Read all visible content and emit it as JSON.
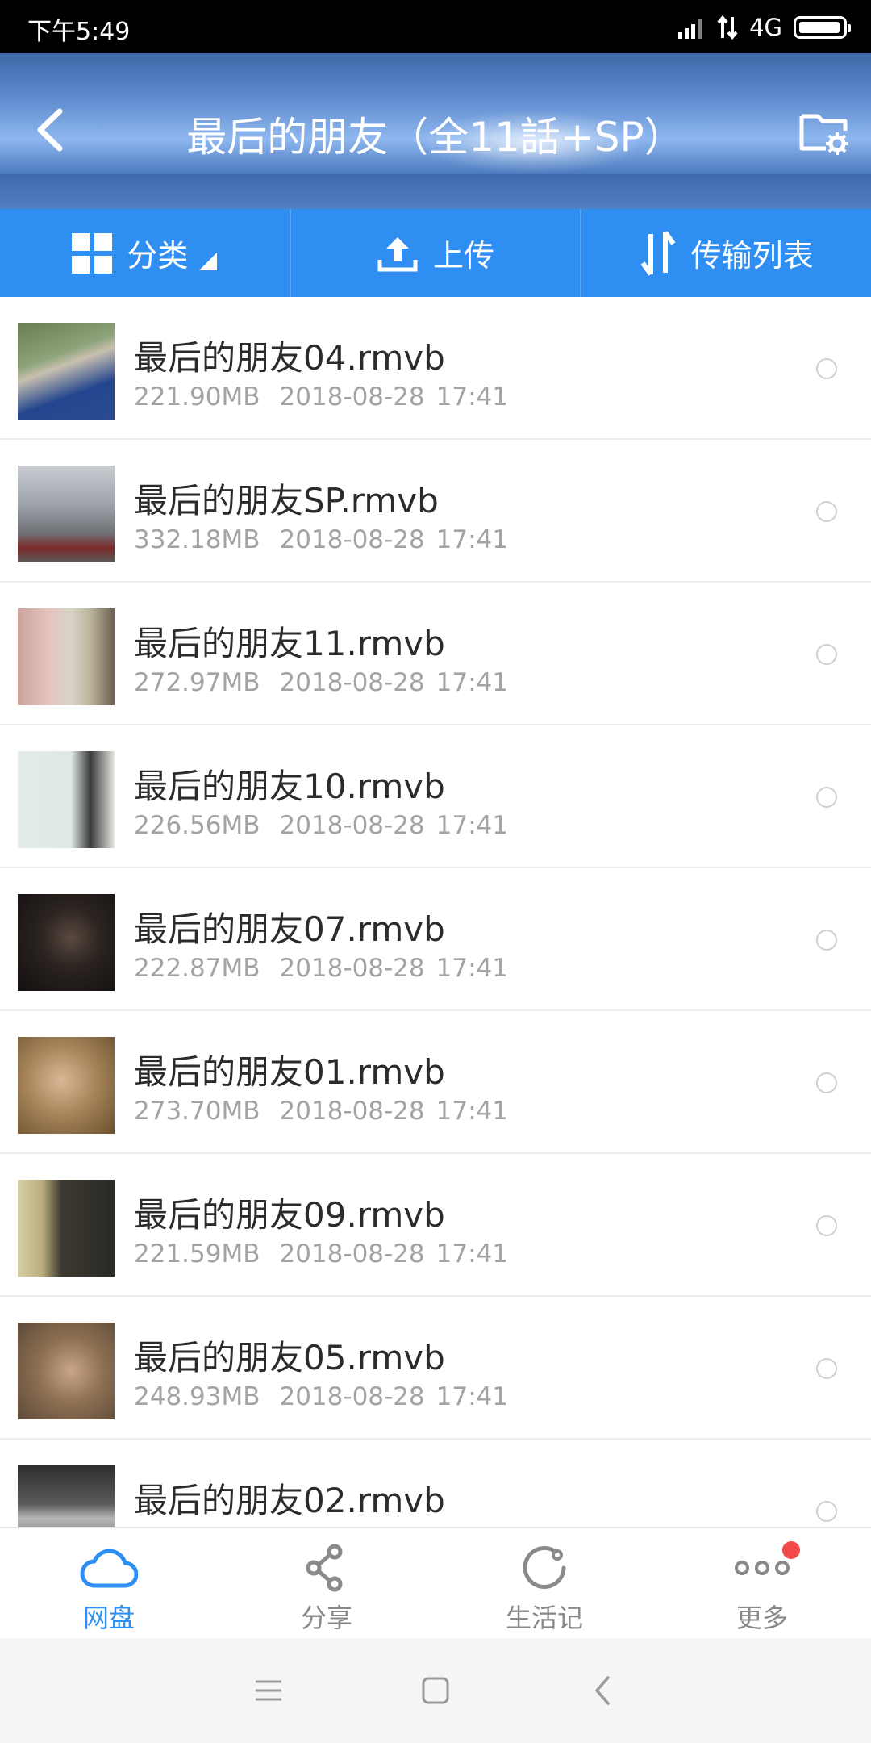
{
  "status_bar": {
    "time": "下午5:49",
    "network": "4G"
  },
  "header": {
    "title": "最后的朋友（全11話+SP）"
  },
  "toolbar": {
    "category": "分类",
    "upload": "上传",
    "transfer": "传输列表"
  },
  "files": [
    {
      "name": "最后的朋友04.rmvb",
      "size": "221.90MB",
      "date": "2018-08-28",
      "time": "17:41"
    },
    {
      "name": "最后的朋友SP.rmvb",
      "size": "332.18MB",
      "date": "2018-08-28",
      "time": "17:41"
    },
    {
      "name": "最后的朋友11.rmvb",
      "size": "272.97MB",
      "date": "2018-08-28",
      "time": "17:41"
    },
    {
      "name": "最后的朋友10.rmvb",
      "size": "226.56MB",
      "date": "2018-08-28",
      "time": "17:41"
    },
    {
      "name": "最后的朋友07.rmvb",
      "size": "222.87MB",
      "date": "2018-08-28",
      "time": "17:41"
    },
    {
      "name": "最后的朋友01.rmvb",
      "size": "273.70MB",
      "date": "2018-08-28",
      "time": "17:41"
    },
    {
      "name": "最后的朋友09.rmvb",
      "size": "221.59MB",
      "date": "2018-08-28",
      "time": "17:41"
    },
    {
      "name": "最后的朋友05.rmvb",
      "size": "248.93MB",
      "date": "2018-08-28",
      "time": "17:41"
    },
    {
      "name": "最后的朋友02.rmvb",
      "size": "",
      "date": "",
      "time": ""
    }
  ],
  "tabs": {
    "disk": "网盘",
    "share": "分享",
    "life": "生活记",
    "more": "更多"
  },
  "colors": {
    "accent": "#2f8ef2",
    "badge": "#f24a4a"
  }
}
